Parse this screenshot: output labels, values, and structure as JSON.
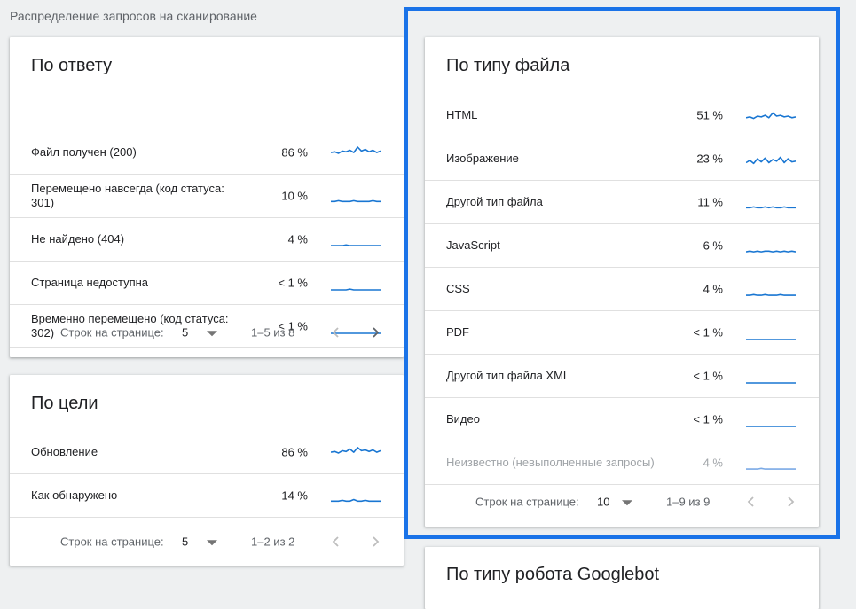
{
  "page": {
    "section_title": "Распределение запросов на сканирование"
  },
  "accent_color": "#1976d2",
  "by_response": {
    "title": "По ответу",
    "rows": [
      {
        "label": "Файл получен (200)",
        "value": "86 %",
        "trend": [
          9,
          10,
          8,
          11,
          10,
          12,
          9,
          16,
          11,
          13,
          10,
          12,
          9,
          11
        ]
      },
      {
        "label": "Перемещено навсегда (код статуса: 301)",
        "value": "10 %",
        "trend": [
          2,
          2,
          3,
          2,
          2,
          2,
          3,
          2,
          2,
          2,
          2,
          3,
          2,
          2
        ]
      },
      {
        "label": "Не найдено (404)",
        "value": "4 %",
        "trend": [
          1,
          1,
          1,
          1,
          2,
          1,
          1,
          1,
          1,
          1,
          1,
          1,
          1,
          1
        ]
      },
      {
        "label": "Страница недоступна",
        "value": "< 1 %",
        "trend": [
          0,
          0,
          0,
          0,
          0,
          1,
          0,
          0,
          0,
          0,
          0,
          0,
          0,
          0
        ]
      },
      {
        "label": "Временно перемещено (код статуса: 302)",
        "value": "< 1 %",
        "trend": [
          0,
          0,
          0,
          0,
          0,
          0,
          0,
          0,
          0,
          0,
          0,
          0,
          0,
          0
        ]
      }
    ],
    "pager": {
      "rows_per_page_label": "Строк на странице:",
      "rows_per_page": "5",
      "range": "1–5 из 8"
    }
  },
  "by_purpose": {
    "title": "По цели",
    "rows": [
      {
        "label": "Обновление",
        "value": "86 %",
        "trend": [
          9,
          10,
          8,
          11,
          10,
          13,
          9,
          15,
          11,
          12,
          10,
          12,
          9,
          11
        ]
      },
      {
        "label": "Как обнаружено",
        "value": "14 %",
        "trend": [
          2,
          2,
          2,
          3,
          2,
          2,
          4,
          2,
          2,
          3,
          2,
          2,
          2,
          2
        ]
      }
    ],
    "pager": {
      "rows_per_page_label": "Строк на странице:",
      "rows_per_page": "5",
      "range": "1–2 из 2"
    }
  },
  "by_file_type": {
    "title": "По типу файла",
    "rows": [
      {
        "label": "HTML",
        "value": "51 %",
        "trend": [
          6,
          7,
          5,
          8,
          7,
          9,
          6,
          12,
          8,
          9,
          7,
          8,
          6,
          7
        ]
      },
      {
        "label": "Изображение",
        "value": "23 %",
        "trend": [
          4,
          7,
          3,
          9,
          5,
          10,
          4,
          8,
          6,
          11,
          4,
          9,
          5,
          6
        ]
      },
      {
        "label": "Другой тип файла",
        "value": "11 %",
        "trend": [
          2,
          2,
          3,
          2,
          2,
          3,
          2,
          3,
          2,
          2,
          3,
          2,
          2,
          2
        ]
      },
      {
        "label": "JavaScript",
        "value": "6 %",
        "trend": [
          1,
          2,
          1,
          2,
          1,
          2,
          2,
          1,
          2,
          1,
          2,
          1,
          2,
          1
        ]
      },
      {
        "label": "CSS",
        "value": "4 %",
        "trend": [
          1,
          1,
          2,
          1,
          1,
          2,
          1,
          1,
          1,
          2,
          1,
          1,
          1,
          1
        ]
      },
      {
        "label": "PDF",
        "value": "< 1 %",
        "trend": [
          0,
          0,
          0,
          0,
          0,
          0,
          0,
          0,
          0,
          0,
          0,
          0,
          0,
          0
        ]
      },
      {
        "label": "Другой тип файла XML",
        "value": "< 1 %",
        "trend": [
          0,
          0,
          0,
          0,
          0,
          0,
          0,
          0,
          0,
          0,
          0,
          0,
          0,
          0
        ]
      },
      {
        "label": "Видео",
        "value": "< 1 %",
        "trend": [
          0,
          0,
          0,
          0,
          0,
          0,
          0,
          0,
          0,
          0,
          0,
          0,
          0,
          0
        ]
      },
      {
        "label": "Неизвестно (невыполненные запросы)",
        "value": "4 %",
        "muted": true,
        "trend": [
          1,
          1,
          1,
          1,
          2,
          1,
          1,
          1,
          1,
          1,
          1,
          1,
          1,
          1
        ]
      }
    ],
    "pager": {
      "rows_per_page_label": "Строк на странице:",
      "rows_per_page": "10",
      "range": "1–9 из 9"
    }
  },
  "by_googlebot": {
    "title": "По типу робота Googlebot"
  },
  "icons": {
    "dropdown": "caret-down-icon",
    "prev": "chevron-left-icon",
    "next": "chevron-right-icon"
  }
}
